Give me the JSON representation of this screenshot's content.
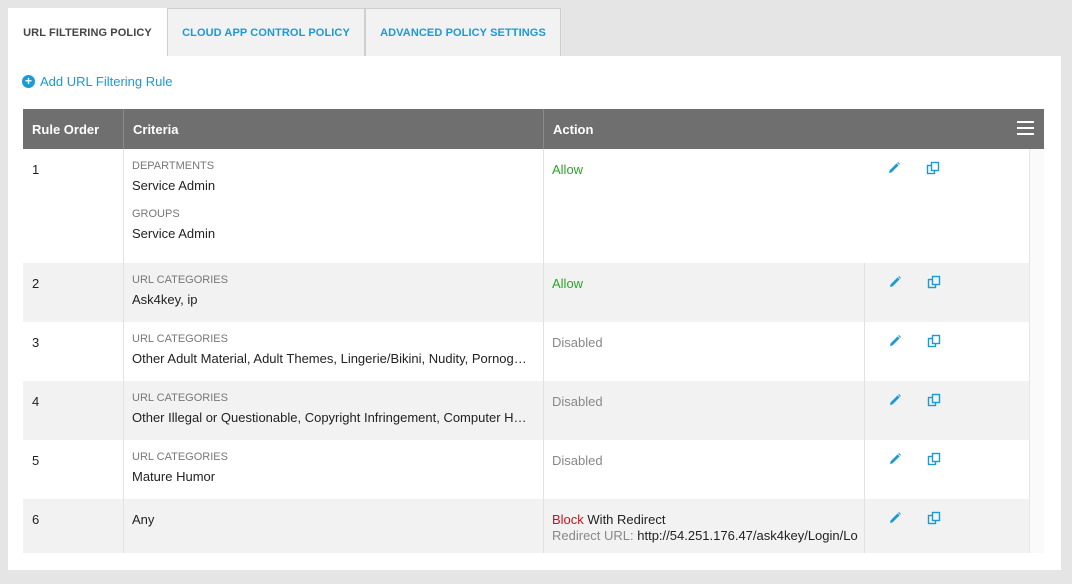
{
  "tabs": [
    {
      "label": "URL FILTERING POLICY",
      "active": true
    },
    {
      "label": "CLOUD APP CONTROL POLICY",
      "active": false
    },
    {
      "label": "ADVANCED POLICY SETTINGS",
      "active": false
    }
  ],
  "add_rule": {
    "label": "Add URL Filtering Rule",
    "icon": "plus-circle-icon"
  },
  "grid": {
    "columns": [
      "Rule Order",
      "Criteria",
      "Action"
    ],
    "menu_icon": "hamburger-menu-icon"
  },
  "rules": [
    {
      "order": "1",
      "criteria": [
        {
          "label": "DEPARTMENTS",
          "value": "Service Admin"
        },
        {
          "label": "GROUPS",
          "value": "Service Admin"
        }
      ],
      "action": "Allow"
    },
    {
      "order": "2",
      "criteria": [
        {
          "label": "URL CATEGORIES",
          "value": "Ask4key, ip"
        }
      ],
      "action": "Allow"
    },
    {
      "order": "3",
      "criteria": [
        {
          "label": "URL CATEGORIES",
          "value": "Other Adult Material, Adult Themes, Lingerie/Bikini, Nudity, Pornog…"
        }
      ],
      "action": "Disabled"
    },
    {
      "order": "4",
      "criteria": [
        {
          "label": "URL CATEGORIES",
          "value": "Other Illegal or Questionable, Copyright Infringement, Computer H…"
        }
      ],
      "action": "Disabled"
    },
    {
      "order": "5",
      "criteria": [
        {
          "label": "URL CATEGORIES",
          "value": "Mature Humor"
        }
      ],
      "action": "Disabled"
    },
    {
      "order": "6",
      "criteria_text": "Any",
      "action_block": "Block",
      "action_suffix": " With Redirect",
      "redirect_label": "Redirect URL:",
      "redirect_url": " http://54.251.176.47/ask4key/Login/Lo"
    }
  ],
  "colors": {
    "accent": "#1a9ad6",
    "allow": "#2aa52a",
    "block": "#c81414",
    "header": "#6f6f6f"
  }
}
